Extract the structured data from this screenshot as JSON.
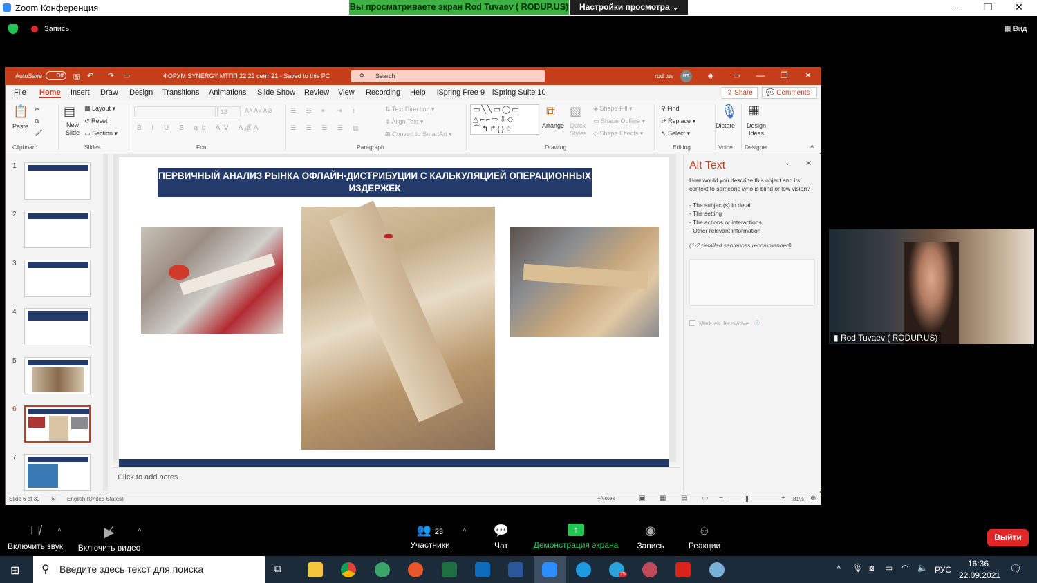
{
  "zoom": {
    "window_title": "Zoom Конференция",
    "banner": "Вы просматриваете экран Rod Tuvaev ( RODUP.US)",
    "view_settings": "Настройки просмотра",
    "recording": "Запись",
    "view": "Вид",
    "participant_name": "Rod Tuvaev ( RODUP.US)",
    "participants_count": "23",
    "bottom": {
      "mute": "Включить звук",
      "video": "Включить видео",
      "participants": "Участники",
      "chat": "Чат",
      "share": "Демонстрация экрана",
      "record": "Запись",
      "reactions": "Реакции",
      "leave": "Выйти"
    }
  },
  "ppt": {
    "autosave": "AutoSave",
    "autosave_state": "Off",
    "doc_title": "ФОРУМ SYNERGY МТПП 22 23 сент 21 - Saved to this PC",
    "search": "Search",
    "user": "rod tuv",
    "user_initials": "RT",
    "tabs": [
      "File",
      "Home",
      "Insert",
      "Draw",
      "Design",
      "Transitions",
      "Animations",
      "Slide Show",
      "Review",
      "View",
      "Recording",
      "Help",
      "iSpring Free 9",
      "iSpring Suite 10"
    ],
    "share": "Share",
    "comments": "Comments",
    "ribbon": {
      "paste": "Paste",
      "clipboard": "Clipboard",
      "new_slide": "New Slide",
      "layout": "Layout",
      "reset": "Reset",
      "section": "Section",
      "slides": "Slides",
      "font_size": "18",
      "font": "Font",
      "text_direction": "Text Direction",
      "align_text": "Align Text",
      "convert_smartart": "Convert to SmartArt",
      "paragraph": "Paragraph",
      "arrange": "Arrange",
      "quick_styles": "Quick Styles",
      "shape_fill": "Shape Fill",
      "shape_outline": "Shape Outline",
      "shape_effects": "Shape Effects",
      "drawing": "Drawing",
      "find": "Find",
      "replace": "Replace",
      "select": "Select",
      "editing": "Editing",
      "dictate": "Dictate",
      "voice": "Voice",
      "design_ideas": "Design Ideas",
      "designer": "Designer"
    },
    "slide_numbers": [
      "1",
      "2",
      "3",
      "4",
      "5",
      "6",
      "7"
    ],
    "active_slide": "6",
    "slide_title": "ПЕРВИЧНЫЙ АНАЛИЗ РЫНКА ОФЛАЙН-ДИСТРИБУЦИИ С КАЛЬКУЛЯЦИЕЙ ОПЕРАЦИОННЫХ ИЗДЕРЖЕК",
    "alt_text": {
      "title": "Alt Text",
      "question": "How would you describe this object and its context to someone who is blind or low vision?",
      "items": [
        "- The subject(s) in detail",
        "- The setting",
        "- The actions or interactions",
        "- Other relevant information"
      ],
      "hint": "(1-2 detailed sentences recommended)",
      "decorative": "Mark as decorative"
    },
    "notes": "Click to add notes",
    "status": {
      "slide": "Slide 6 of 30",
      "language": "English (United States)",
      "notes": "Notes",
      "zoom": "81%"
    }
  },
  "taskbar": {
    "search": "Введите здесь текст для поиска",
    "lang": "РУС",
    "time": "16:36",
    "date": "22.09.2021",
    "telegram_badge": "75"
  }
}
